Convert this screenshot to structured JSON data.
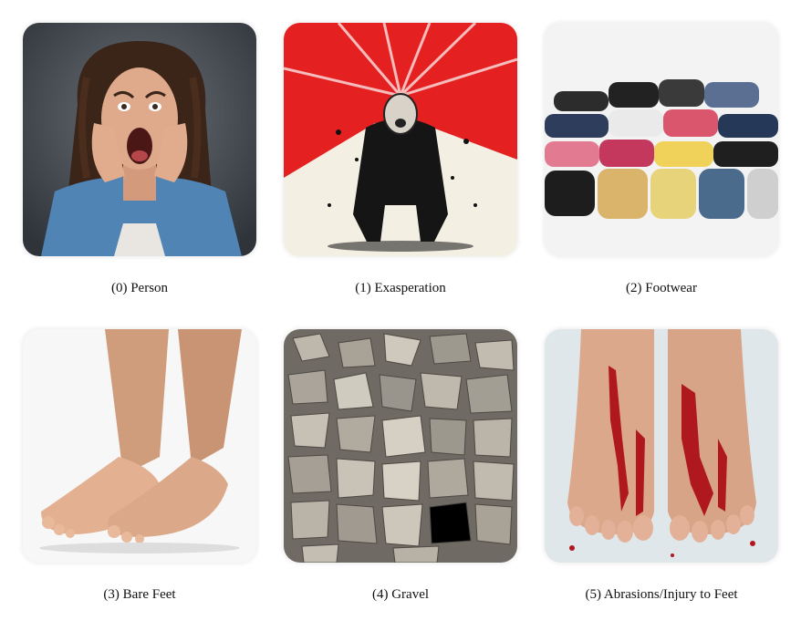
{
  "items": [
    {
      "caption": "(0) Person"
    },
    {
      "caption": "(1) Exasperation"
    },
    {
      "caption": "(2) Footwear"
    },
    {
      "caption": "(3) Bare Feet"
    },
    {
      "caption": "(4) Gravel"
    },
    {
      "caption": "(5) Abrasions/Injury to Feet"
    }
  ]
}
